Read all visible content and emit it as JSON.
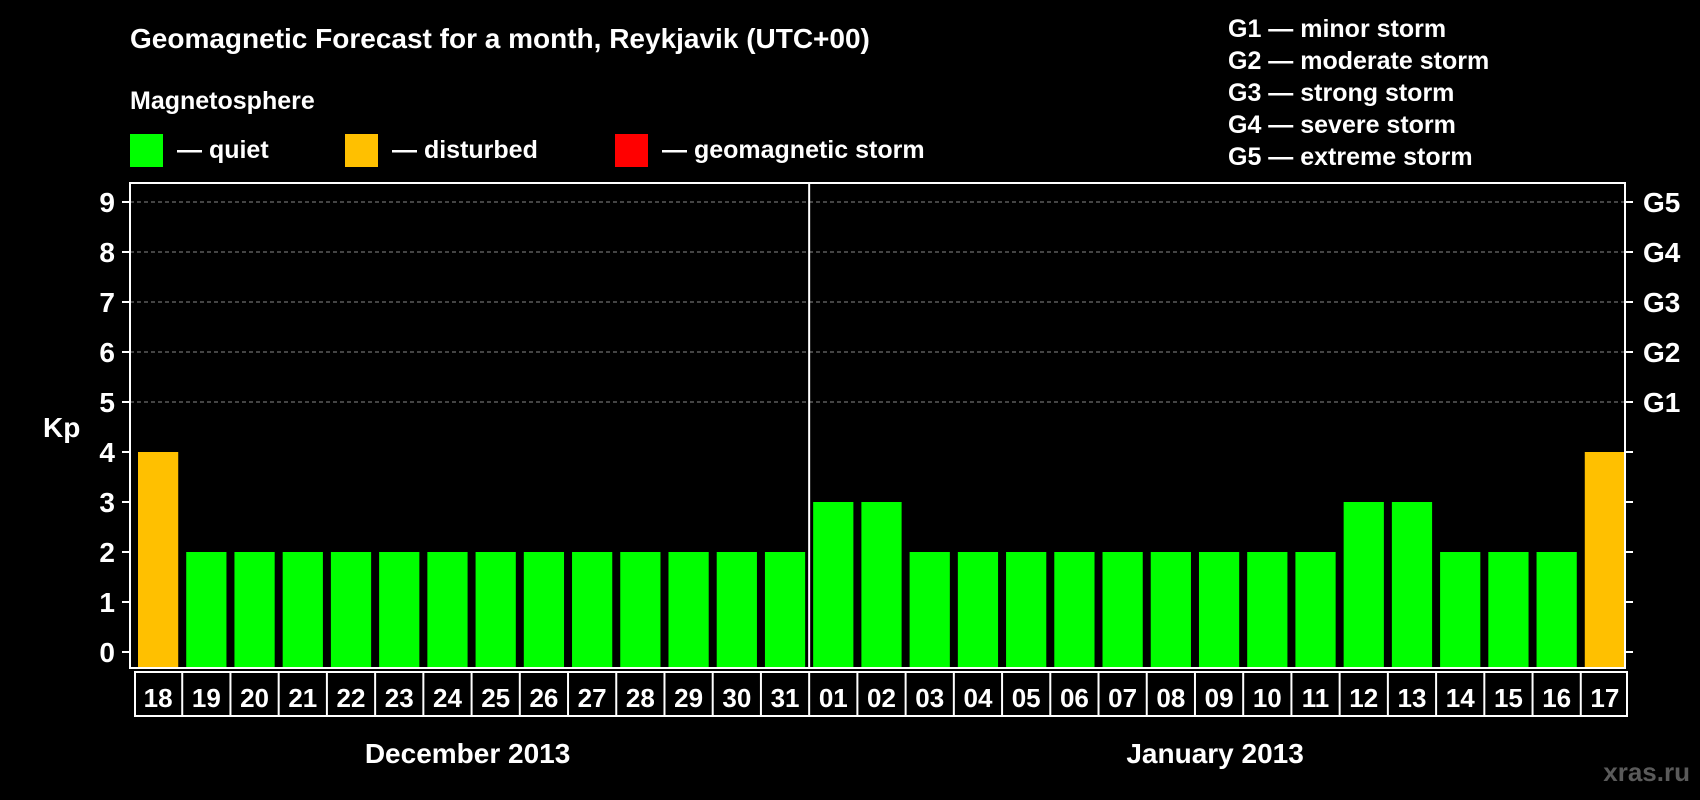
{
  "chart_data": {
    "type": "bar",
    "title": "Geomagnetic Forecast for a month, Reykjavik (UTC+00)",
    "ylabel": "Kp",
    "ylim": [
      0,
      9
    ],
    "y_ticks": [
      "0",
      "1",
      "2",
      "3",
      "4",
      "5",
      "6",
      "7",
      "8",
      "9"
    ],
    "right_ticks": [
      {
        "value": 5,
        "label": "G1"
      },
      {
        "value": 6,
        "label": "G2"
      },
      {
        "value": 7,
        "label": "G3"
      },
      {
        "value": 8,
        "label": "G4"
      },
      {
        "value": 9,
        "label": "G5"
      }
    ],
    "categories": [
      "18",
      "19",
      "20",
      "21",
      "22",
      "23",
      "24",
      "25",
      "26",
      "27",
      "28",
      "29",
      "30",
      "31",
      "01",
      "02",
      "03",
      "04",
      "05",
      "06",
      "07",
      "08",
      "09",
      "10",
      "11",
      "12",
      "13",
      "14",
      "15",
      "16",
      "17"
    ],
    "values": [
      4,
      2,
      2,
      2,
      2,
      2,
      2,
      2,
      2,
      2,
      2,
      2,
      2,
      2,
      3,
      3,
      2,
      2,
      2,
      2,
      2,
      2,
      2,
      2,
      2,
      3,
      3,
      2,
      2,
      2,
      4
    ],
    "months": [
      {
        "label": "December 2013",
        "days": 14
      },
      {
        "label": "January 2013",
        "days": 17
      }
    ],
    "legend": {
      "heading": "Magnetosphere",
      "items": [
        {
          "label": "— quiet",
          "color": "#00ff00"
        },
        {
          "label": "— disturbed",
          "color": "#ffc000"
        },
        {
          "label": "— geomagnetic storm",
          "color": "#ff0000"
        }
      ]
    },
    "storm_scale": [
      "G1 — minor storm",
      "G2 — moderate storm",
      "G3 — strong storm",
      "G4 — severe storm",
      "G5 — extreme storm"
    ],
    "colors": {
      "quiet": "#00ff00",
      "disturbed": "#ffc000",
      "storm": "#ff0000",
      "grid": "#888888",
      "axis": "#ffffff",
      "background": "#000000"
    },
    "thresholds": {
      "disturbed_min": 4,
      "storm_min": 5
    },
    "grid": true
  },
  "watermark": "xras.ru"
}
